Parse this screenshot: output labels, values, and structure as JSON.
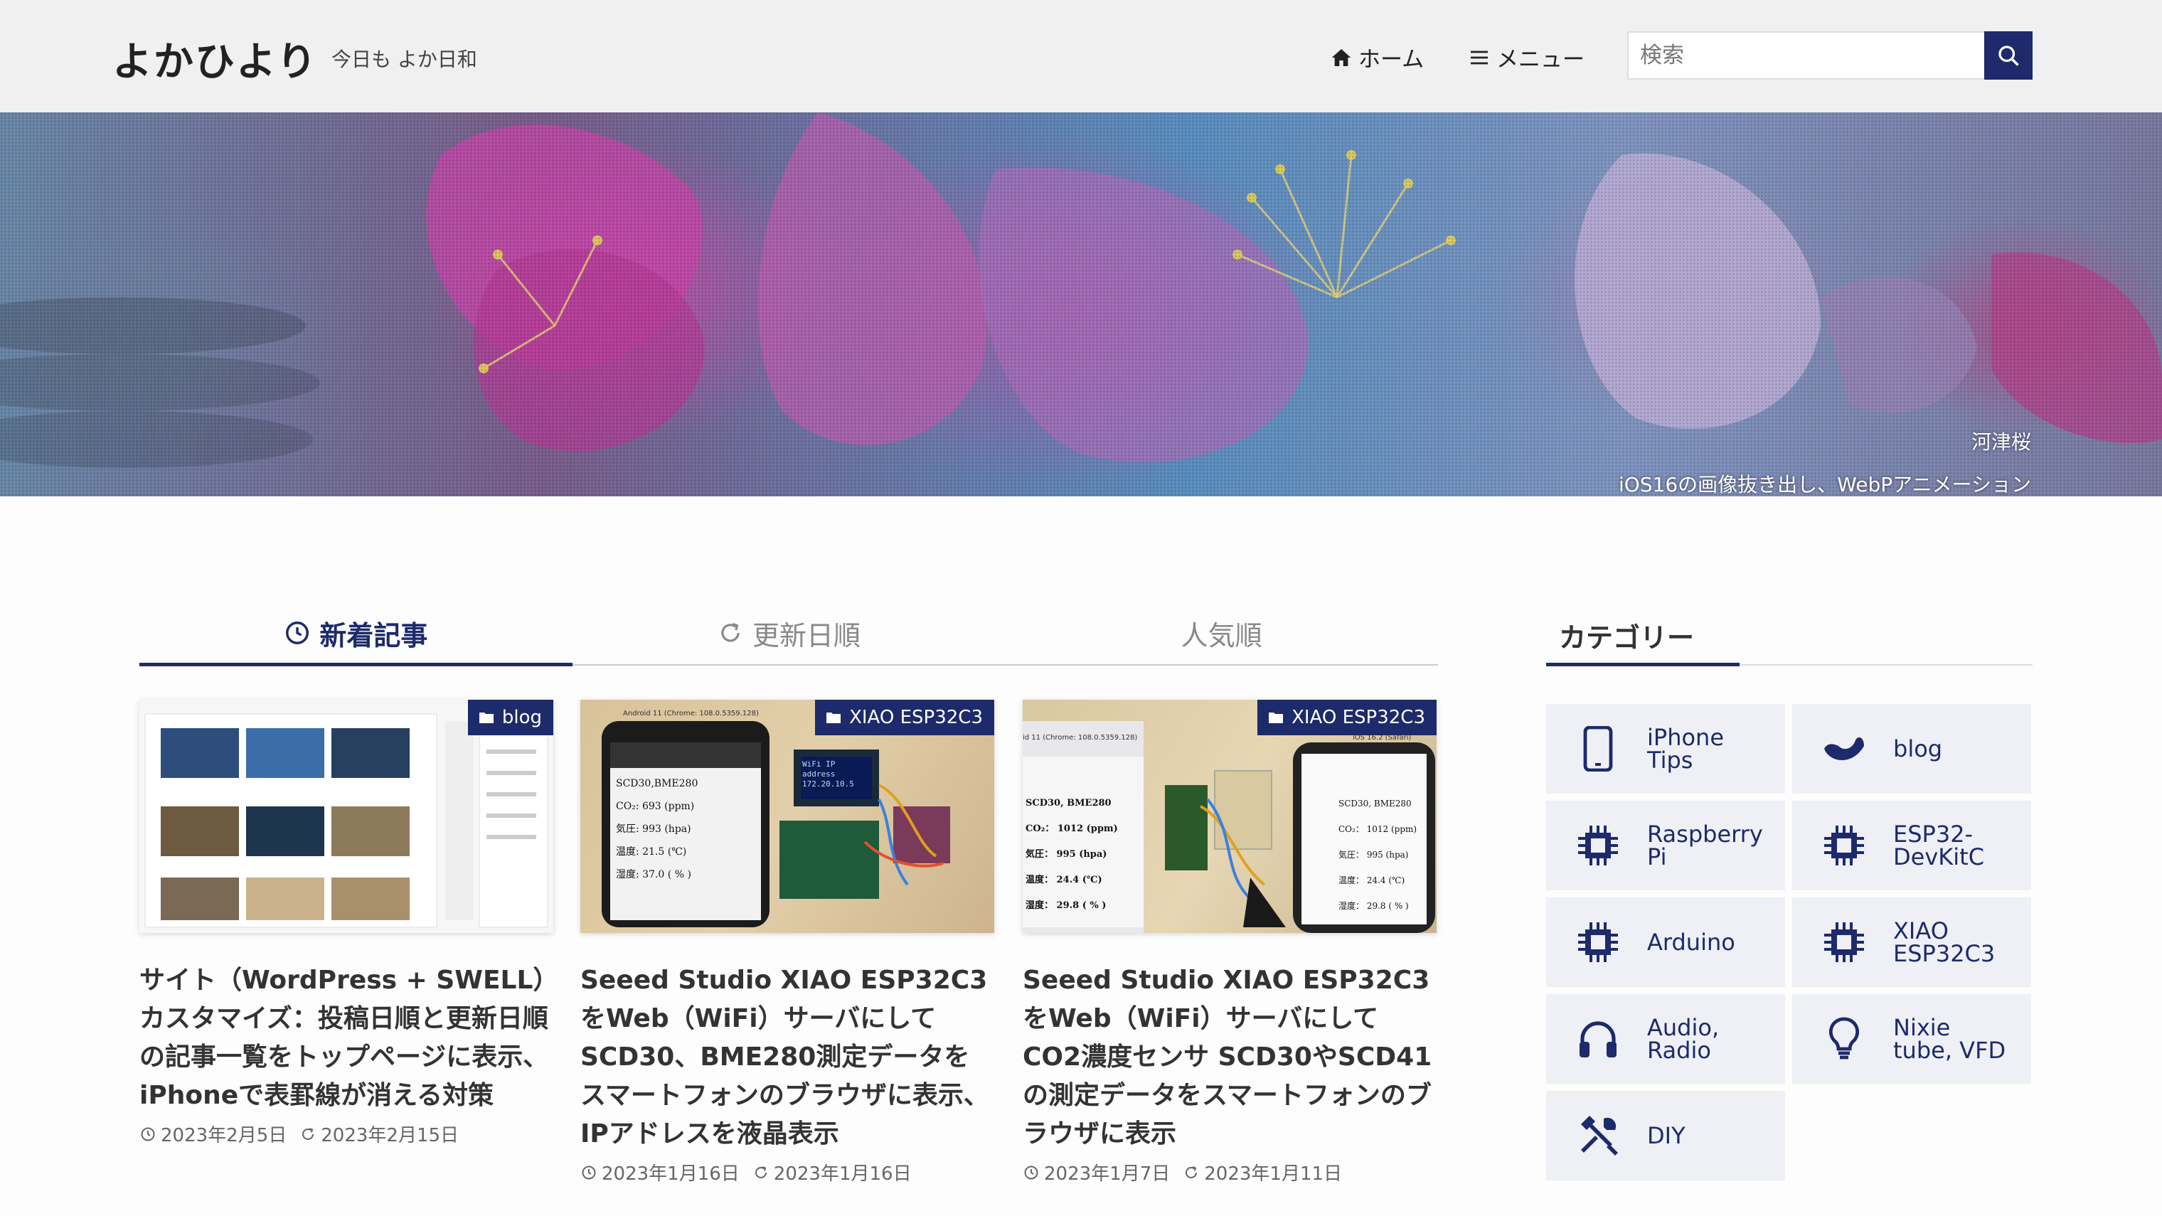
{
  "header": {
    "site_title": "よかひより",
    "tagline": "今日も よか日和",
    "nav_home": "ホーム",
    "nav_menu": "メニュー",
    "search_placeholder": "検索"
  },
  "hero": {
    "caption_title": "河津桜",
    "caption_sub": "iOS16の画像抜き出し、WebPアニメーション"
  },
  "tabs": [
    {
      "label": "新着記事",
      "active": true,
      "icon": "clock-icon"
    },
    {
      "label": "更新日順",
      "active": false,
      "icon": "refresh-icon"
    },
    {
      "label": "人気順",
      "active": false
    }
  ],
  "posts": [
    {
      "category": "blog",
      "title": "サイト（WordPress + SWELL）カスタマイズ：投稿日順と更新日順の記事一覧をトップページに表示、iPhoneで表罫線が消える対策",
      "published": "2023年2月5日",
      "updated": "2023年2月15日"
    },
    {
      "category": "XIAO ESP32C3",
      "title": "Seeed Studio XIAO ESP32C3をWeb（WiFi）サーバにしてSCD30、BME280測定データをスマートフォンのブラウザに表示、IPアドレスを液晶表示",
      "published": "2023年1月16日",
      "updated": "2023年1月16日",
      "thumb_text": {
        "header": "Android 11 (Chrome: 108.0.5359.128)",
        "l1": "SCD30,BME280",
        "l2": "CO₂: 693 (ppm)",
        "l3": "気圧: 993 (hpa)",
        "l4": "温度: 21.5 (℃)",
        "l5": "湿度: 37.0 ( % )",
        "lcd": "WiFi IP address\n172.20.10.5"
      }
    },
    {
      "category": "XIAO ESP32C3",
      "title": "Seeed Studio XIAO ESP32C3をWeb（WiFi）サーバにしてCO2濃度センサ SCD30やSCD41の測定データをスマートフォンのブラウザに表示",
      "published": "2023年1月7日",
      "updated": "2023年1月11日",
      "thumb_text": {
        "header_left": "id 11 (Chrome: 108.0.5359.128)",
        "header_right": "iOS 16.2 (Safari)",
        "l1": "SCD30, BME280",
        "l2": "CO₂： 1012 (ppm)",
        "l3": "気圧： 995 (hpa)",
        "l4": "温度： 24.4 (℃)",
        "l5": "湿度： 29.8 ( % )"
      }
    }
  ],
  "sidebar": {
    "title": "カテゴリー",
    "categories": [
      {
        "label": "iPhone\nTips",
        "icon": "smartphone-icon"
      },
      {
        "label": "blog",
        "icon": "swell-logo-icon"
      },
      {
        "label": "Raspberry\nPi",
        "icon": "chip-icon"
      },
      {
        "label": "ESP32-\nDevKitC",
        "icon": "chip-icon"
      },
      {
        "label": "Arduino",
        "icon": "chip-icon"
      },
      {
        "label": "XIAO\nESP32C3",
        "icon": "chip-icon"
      },
      {
        "label": "Audio,\nRadio",
        "icon": "headphones-icon"
      },
      {
        "label": "Nixie\ntube, VFD",
        "icon": "lightbulb-icon"
      },
      {
        "label": "DIY",
        "icon": "tools-icon"
      }
    ]
  },
  "colors": {
    "accent": "#1d2a6b",
    "header_bg": "#f0f0f1",
    "category_bg": "#eef0f5"
  }
}
